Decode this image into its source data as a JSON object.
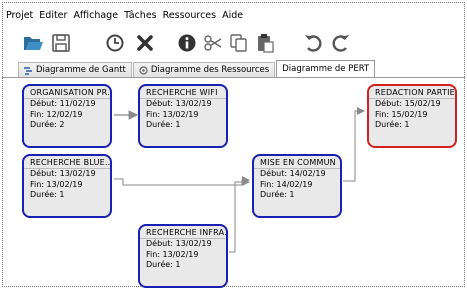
{
  "menu": [
    "Projet",
    "Editer",
    "Affichage",
    "Tâches",
    "Ressources",
    "Aide"
  ],
  "toolbar": [
    "open-folder-icon",
    "save-icon",
    "clock-icon",
    "delete-icon",
    "info-icon",
    "cut-icon",
    "copy-icon",
    "paste-icon",
    "undo-icon",
    "redo-icon"
  ],
  "tabs": [
    {
      "label": "Diagramme de Gantt",
      "active": false
    },
    {
      "label": "Diagramme des Ressources",
      "active": false
    },
    {
      "label": "Diagramme de PERT",
      "active": true
    }
  ],
  "nodes": [
    {
      "title": "ORGANISATION PR...",
      "debut": "Début: 11/02/19",
      "fin": "Fin: 12/02/19",
      "duree": "Durée: 2",
      "critical": false
    },
    {
      "title": "RECHERCHE WIFI",
      "debut": "Début: 13/02/19",
      "fin": "Fin: 13/02/19",
      "duree": "Durée: 1",
      "critical": false
    },
    {
      "title": "RECHERCHE BLUE...",
      "debut": "Début: 13/02/19",
      "fin": "Fin: 13/02/19",
      "duree": "Durée: 1",
      "critical": false
    },
    {
      "title": "MISE EN COMMUN",
      "debut": "Début: 14/02/19",
      "fin": "Fin: 14/02/19",
      "duree": "Durée: 1",
      "critical": false
    },
    {
      "title": "RECHERCHE INFRA...",
      "debut": "Début: 13/02/19",
      "fin": "Fin: 13/02/19",
      "duree": "Durée: 1",
      "critical": false
    },
    {
      "title": "REDACTION PARTIE...",
      "debut": "Début: 15/02/19",
      "fin": "Fin: 15/02/19",
      "duree": "Durée: 1",
      "critical": true
    }
  ],
  "colors": {
    "normal_border": "#1a20b0",
    "critical_border": "#d42020",
    "node_fill": "#e9e9e9",
    "link": "#888888"
  }
}
